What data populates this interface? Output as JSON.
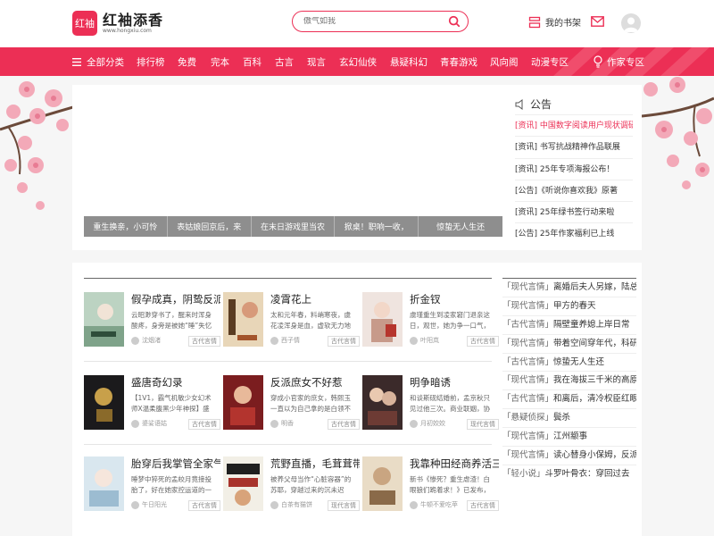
{
  "header": {
    "logo_badge": "红袖",
    "logo_name": "红袖添香",
    "logo_url": "www.hongxiu.com",
    "search_placeholder": "傲气如我",
    "shelf_label": "我的书架"
  },
  "nav": {
    "items": [
      "全部分类",
      "排行榜",
      "免费",
      "完本",
      "百科",
      "古言",
      "现言",
      "玄幻仙侠",
      "悬疑科幻",
      "青春游戏",
      "风向阁",
      "动漫专区"
    ],
    "author_zone": "作家专区"
  },
  "banner": {
    "slides": [
      "重生换亲，小可怜",
      "表姑娘回京后，来",
      "在末日游戏里当农",
      "掀桌！职响一收，",
      "惊蛰无人生还"
    ]
  },
  "notice": {
    "title": "公告",
    "items": [
      "[资讯] 中国数字阅读用户现状调研",
      "[资讯] 书写抗战精神作品联展",
      "[资讯] 25年专项海报公布！",
      "[公告]《听说你喜欢我》原著",
      "[资讯] 25年绿书签行动来啦",
      "[公告] 25年作家福利已上线"
    ]
  },
  "books": [
    {
      "title": "假孕成真，阴鸷反派",
      "desc": "云昭渺穿书了，醒来时浑身酸疼，身旁是被她“睡”失忆",
      "author": "沈烟渚",
      "tag": "古代言情"
    },
    {
      "title": "凌霄花上",
      "desc": "太和元年春，料峭寒夜，虞花凌浑身是血，虚软无力地",
      "author": "西子情",
      "tag": "古代言情"
    },
    {
      "title": "折金钗",
      "desc": "虞瑾重生到凌家窘门退亲这日，观世，她为争一口气，",
      "author": "叶阳岚",
      "tag": "古代言情"
    },
    {
      "title": "盛唐奇幻录",
      "desc": "【1V1，霸气机敏少女幻术师X温柔腹黑少年神探】盛",
      "author": "婆娑语姑",
      "tag": "古代言情"
    },
    {
      "title": "反派庶女不好惹",
      "desc": "穿成小官家的庶女，韩熙玉一直以为自己拿的是白领不",
      "author": "明香",
      "tag": "古代言情"
    },
    {
      "title": "明争暗诱",
      "desc": "和谈斯砚结婚前，孟京秋只见过他三次。商业联姻，协",
      "author": "月初姣姣",
      "tag": "现代言情"
    },
    {
      "title": "胎穿后我掌管全家气",
      "desc": "睡梦中猝死的孟皎月竟接投胎了，好在她家控运道的一",
      "author": "午日阳光",
      "tag": "古代言情"
    },
    {
      "title": "荒野直播，毛茸茸带",
      "desc": "被养父母当作“心脏容器”的苏耶，穿越过来的沉未迟",
      "author": "白茶有猫饼",
      "tag": "现代言情"
    },
    {
      "title": "我靠种田经商养活三",
      "desc": "新书《惨死？重生虐渣！白眼狼们跪着求！》已发布，",
      "author": "牛顿不爱吃苹",
      "tag": "古代言情"
    }
  ],
  "rank": [
    {
      "cat": "「现代言情」",
      "title": "离婚后夫人另嫁，陆总"
    },
    {
      "cat": "「现代言情」",
      "title": "甲方的春天"
    },
    {
      "cat": "「古代言情」",
      "title": "隔壁童养媳上岸日常"
    },
    {
      "cat": "「现代言情」",
      "title": "带着空间穿年代，科研"
    },
    {
      "cat": "「古代言情」",
      "title": "惊蛰无人生还"
    },
    {
      "cat": "「现代言情」",
      "title": "我在海拔三千米的高原"
    },
    {
      "cat": "「古代言情」",
      "title": "和离后，清冷权臣红眼"
    },
    {
      "cat": "「悬疑侦探」",
      "title": "鬓杀"
    },
    {
      "cat": "「现代言情」",
      "title": "江州颛事"
    },
    {
      "cat": "「现代言情」",
      "title": "读心替身小保姆，反派"
    },
    {
      "cat": "「轻小说」",
      "title": "斗罗叶骨衣：穿回过去"
    }
  ],
  "colors": {
    "brand": "#ec2f55",
    "slide_bg": "#8e8e8e"
  }
}
